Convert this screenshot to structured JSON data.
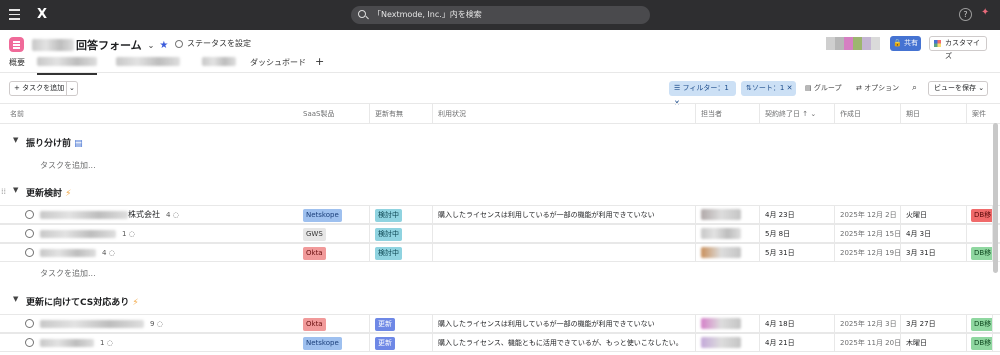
{
  "topbar": {
    "search_placeholder": "「Nextmode, Inc.」内を検索",
    "help": "?"
  },
  "project": {
    "title_suffix": "回答フォーム",
    "status": "ステータスを設定",
    "share": "共有",
    "customize": "カスタマイズ"
  },
  "tabs": [
    {
      "label": "概要"
    },
    {
      "label": ""
    },
    {
      "label": ""
    },
    {
      "label": ""
    },
    {
      "label": "ダッシュボード"
    },
    {
      "label": "+"
    }
  ],
  "toolbar": {
    "add_task": "+ タスクを追加",
    "filter": "フィルター：1",
    "sort": "ソート：1",
    "group": "グループ",
    "options": "オプション",
    "save_view": "ビューを保存"
  },
  "columns": [
    "名前",
    "SaaS製品",
    "更新有無",
    "利用状況",
    "担当者",
    "契約終了日",
    "作成日",
    "期日",
    "案件"
  ],
  "sort_indicator": "↑",
  "sections": [
    {
      "name": "振り分け前",
      "add": "タスクを追加...",
      "rows": []
    },
    {
      "name": "更新検討",
      "add": "タスクを追加...",
      "rows": [
        {
          "name": "株式会社",
          "comments": "4",
          "saas": "Netskope",
          "saas_color": "blue",
          "update": "検討中",
          "update_color": "teal",
          "usage": "購入したライセンスは利用しているが一部の機能が利用できていない",
          "end": "4月 23日",
          "created": "2025年 12月 2日",
          "due": "火曜日",
          "case": "DB移",
          "case_color": "reddb"
        },
        {
          "name": "",
          "comments": "1",
          "saas": "GWS",
          "saas_color": "gray",
          "update": "検討中",
          "update_color": "teal",
          "usage": "",
          "end": "5月 8日",
          "created": "2025年 12月 15日",
          "due": "4月 3日",
          "case": "",
          "case_color": ""
        },
        {
          "name": "",
          "comments": "4",
          "saas": "Okta",
          "saas_color": "red",
          "update": "検討中",
          "update_color": "teal",
          "usage": "",
          "end": "5月 31日",
          "created": "2025年 12月 19日",
          "due": "3月 31日",
          "case": "DB移",
          "case_color": "greendb"
        }
      ]
    },
    {
      "name": "更新に向けてCS対応あり",
      "add": "",
      "rows": [
        {
          "name": "",
          "comments": "9",
          "saas": "Okta",
          "saas_color": "red",
          "update": "更新",
          "update_color": "indigo",
          "usage": "購入したライセンスは利用しているが一部の機能が利用できていない",
          "end": "4月 18日",
          "created": "2025年 12月 3日",
          "due": "3月 27日",
          "case": "DB移",
          "case_color": "greendb"
        },
        {
          "name": "",
          "comments": "1",
          "saas": "Netskope",
          "saas_color": "blue",
          "update": "更新",
          "update_color": "indigo",
          "usage": "購入したライセンス、機能ともに活用できているが、もっと使いこなしたい。",
          "end": "4月 21日",
          "created": "2025年 11月 20日",
          "due": "木曜日",
          "case": "DB移",
          "case_color": "greendb"
        }
      ]
    }
  ]
}
